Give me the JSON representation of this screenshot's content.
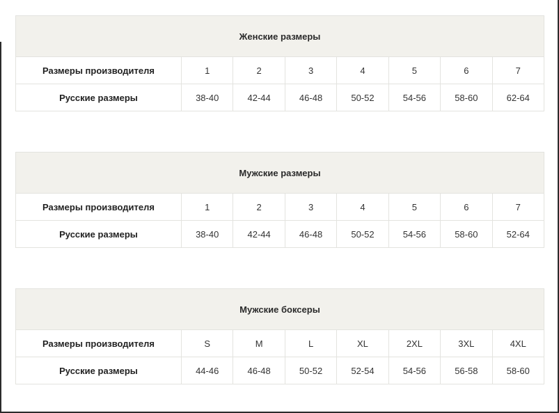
{
  "tables": [
    {
      "title": "Женские размеры",
      "rows": [
        {
          "label": "Размеры производителя",
          "values": [
            "1",
            "2",
            "3",
            "4",
            "5",
            "6",
            "7"
          ]
        },
        {
          "label": "Русские размеры",
          "values": [
            "38-40",
            "42-44",
            "46-48",
            "50-52",
            "54-56",
            "58-60",
            "62-64"
          ]
        }
      ]
    },
    {
      "title": "Мужские размеры",
      "rows": [
        {
          "label": "Размеры производителя",
          "values": [
            "1",
            "2",
            "3",
            "4",
            "5",
            "6",
            "7"
          ]
        },
        {
          "label": "Русские размеры",
          "values": [
            "38-40",
            "42-44",
            "46-48",
            "50-52",
            "54-56",
            "58-60",
            "52-64"
          ]
        }
      ]
    },
    {
      "title": "Мужские боксеры",
      "rows": [
        {
          "label": "Размеры производителя",
          "values": [
            "S",
            "M",
            "L",
            "XL",
            "2XL",
            "3XL",
            "4XL"
          ]
        },
        {
          "label": "Русские размеры",
          "values": [
            "44-46",
            "46-48",
            "50-52",
            "52-54",
            "54-56",
            "56-58",
            "58-60"
          ]
        }
      ]
    }
  ]
}
